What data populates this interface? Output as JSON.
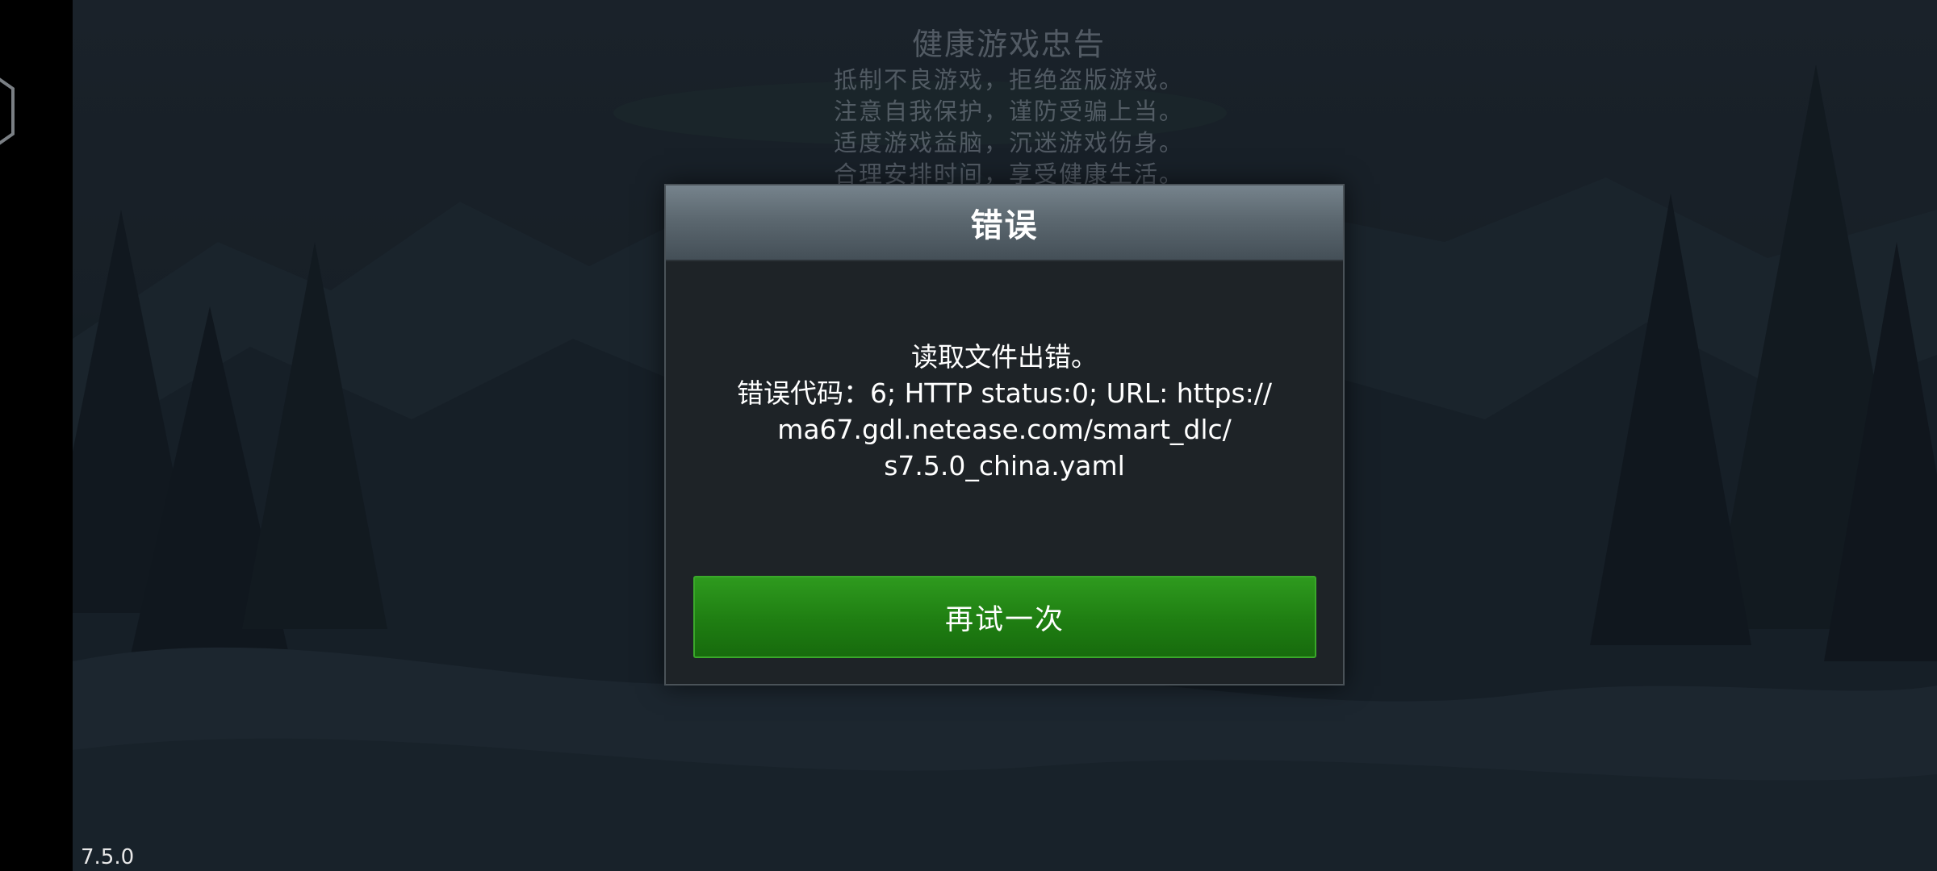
{
  "advisory": {
    "title": "健康游戏忠告",
    "lines": [
      "抵制不良游戏，拒绝盗版游戏。",
      "注意自我保护，谨防受骗上当。",
      "适度游戏益脑，沉迷游戏伤身。",
      "合理安排时间，享受健康生活。"
    ]
  },
  "dialog": {
    "title": "错误",
    "message_line1": "读取文件出错。",
    "message_line2": "错误代码：6; HTTP status:0; URL: https://",
    "message_line3": "ma67.gdl.netease.com/smart_dlc/",
    "message_line4": "s7.5.0_china.yaml",
    "retry_label": "再试一次"
  },
  "version": "7.5.0",
  "colors": {
    "button_green": "#1f7e12",
    "dialog_bg": "#1e2327",
    "header_gray": "#5c6870"
  },
  "icons": {
    "left_edge": "hexagon-icon"
  }
}
